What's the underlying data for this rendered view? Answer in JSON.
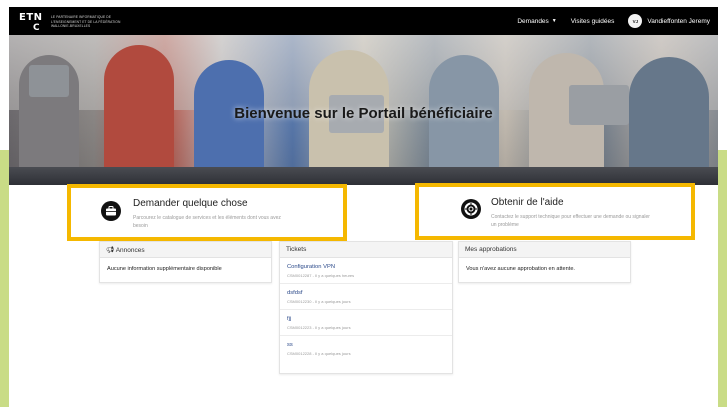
{
  "nav": {
    "logo_text": "ETNIC",
    "logo_tagline": "LE PARTENAIRE INFORMATIQUE DE L'ENSEIGNEMENT ET DE LA FÉDÉRATION WALLONIE-BRUXELLES",
    "requests_label": "Demandes",
    "tours_label": "Visites guidées",
    "user_initials": "VJ",
    "user_name": "Vandieffonten Jeremy"
  },
  "hero": {
    "title": "Bienvenue sur le Portail bénéficiaire"
  },
  "cards": {
    "request": {
      "title": "Demander quelque chose",
      "description": "Parcourez le catalogue de services et les éléments dont vous avez besoin",
      "icon": "briefcase-icon"
    },
    "help": {
      "title": "Obtenir de l'aide",
      "description": "Contactez le support technique pour effectuer une demande ou signaler un problème",
      "icon": "lifebuoy-icon"
    }
  },
  "announcements": {
    "title": "Annonces",
    "empty_text": "Aucune information supplémentaire disponible"
  },
  "tickets": {
    "title": "Tickets",
    "items": [
      {
        "title": "Configuration VPN",
        "meta": "CSM0012287 - Il y a quelques heures"
      },
      {
        "title": "dsfdsf",
        "meta": "CSM0012230 - Il y a quelques jours"
      },
      {
        "title": "fjj",
        "meta": "CSM0012223 - Il y a quelques jours"
      },
      {
        "title": "ss",
        "meta": "CSM0012228 - Il y a quelques jours"
      }
    ]
  },
  "approvals": {
    "title": "Mes approbations",
    "empty_text": "Vous n'avez aucune approbation en attente."
  },
  "colors": {
    "highlight": "#f5b800",
    "nav_bg": "#000000",
    "side_strip": "#c9dc86"
  }
}
